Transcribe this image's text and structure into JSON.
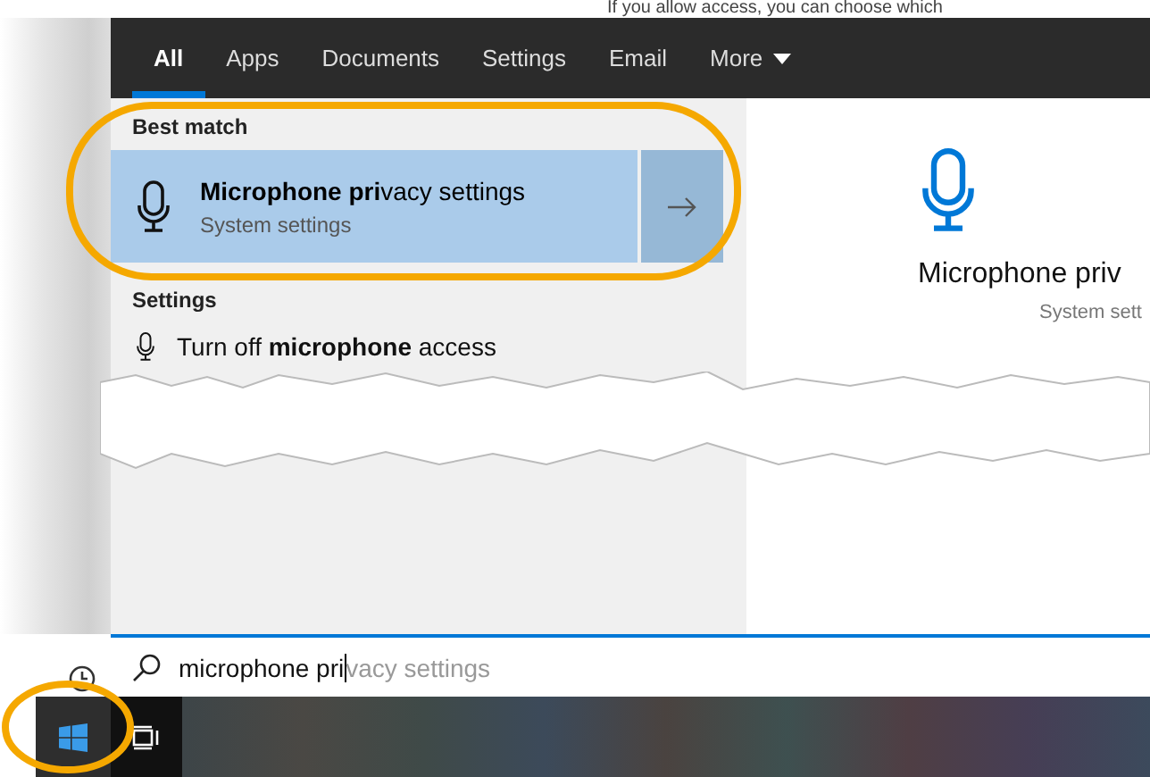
{
  "background_text": "If you allow access, you can choose which",
  "tabs": [
    {
      "label": "All",
      "selected": true,
      "has_menu": false
    },
    {
      "label": "Apps",
      "selected": false,
      "has_menu": false
    },
    {
      "label": "Documents",
      "selected": false,
      "has_menu": false
    },
    {
      "label": "Settings",
      "selected": false,
      "has_menu": false
    },
    {
      "label": "Email",
      "selected": false,
      "has_menu": false
    },
    {
      "label": "More",
      "selected": false,
      "has_menu": true
    }
  ],
  "sections": [
    {
      "heading": "Best match",
      "items": [
        {
          "kind": "large",
          "title": "**Microphone pri**vacy settings",
          "subtitle": "System settings",
          "selected": true
        }
      ]
    },
    {
      "heading": "Settings",
      "items": [
        {
          "kind": "small",
          "title": "Turn off **microphone** access",
          "selected": false
        }
      ]
    }
  ],
  "preview": {
    "title": "Microphone priv",
    "subtitle": "System sett"
  },
  "search": {
    "value": "microphone pri",
    "suggestion": "vacy settings"
  }
}
